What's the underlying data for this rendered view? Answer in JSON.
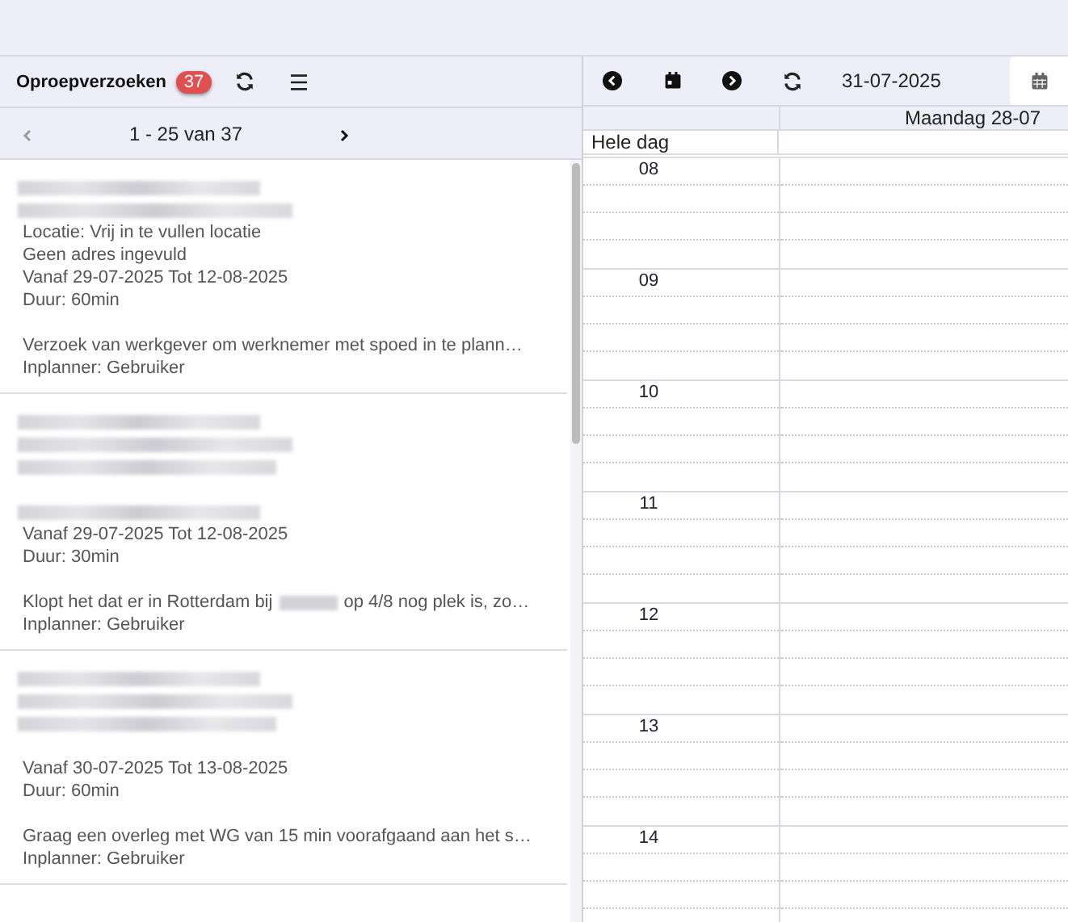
{
  "requests_panel": {
    "title": "Oproepverzoeken",
    "count": "37",
    "pagination": {
      "range": "1 - 25 van 37",
      "prev_disabled": true,
      "next_disabled": false
    },
    "requests": [
      {
        "lines": [
          {
            "kind": "redacted"
          },
          {
            "kind": "redacted"
          },
          {
            "kind": "text",
            "text": "Locatie: Vrij in te vullen locatie"
          },
          {
            "kind": "text",
            "text": "Geen adres ingevuld"
          },
          {
            "kind": "text",
            "text": "Vanaf 29-07-2025 Tot 12-08-2025"
          },
          {
            "kind": "text",
            "text": "Duur: 60min"
          },
          {
            "kind": "blank"
          },
          {
            "kind": "text",
            "text": "Verzoek van werkgever om werknemer met spoed in te plann…"
          },
          {
            "kind": "text",
            "text": "Inplanner: Gebruiker"
          }
        ]
      },
      {
        "lines": [
          {
            "kind": "redacted"
          },
          {
            "kind": "redacted"
          },
          {
            "kind": "redacted"
          },
          {
            "kind": "blank"
          },
          {
            "kind": "redacted"
          },
          {
            "kind": "text",
            "text": "Vanaf 29-07-2025 Tot 12-08-2025"
          },
          {
            "kind": "text",
            "text": "Duur: 30min"
          },
          {
            "kind": "blank"
          },
          {
            "kind": "partly_redacted",
            "parts": [
              "Klopt het dat er in Rotterdam bij",
              "op 4/8 nog plek is, zo…"
            ]
          },
          {
            "kind": "text",
            "text": "Inplanner: Gebruiker"
          }
        ]
      },
      {
        "lines": [
          {
            "kind": "redacted"
          },
          {
            "kind": "redacted"
          },
          {
            "kind": "redacted"
          },
          {
            "kind": "blank"
          },
          {
            "kind": "text",
            "text": "Vanaf 30-07-2025 Tot 13-08-2025"
          },
          {
            "kind": "text",
            "text": "Duur: 60min"
          },
          {
            "kind": "blank"
          },
          {
            "kind": "text",
            "text": "Graag een overleg met WG van 15 min voorafgaand aan het s…"
          },
          {
            "kind": "text",
            "text": "Inplanner: Gebruiker"
          }
        ]
      }
    ]
  },
  "calendar": {
    "date": "31-07-2025",
    "day_header": "Maandag 28-07",
    "all_day_label": "Hele dag",
    "hours": [
      "08",
      "09",
      "10",
      "11",
      "12",
      "13",
      "14"
    ]
  }
}
